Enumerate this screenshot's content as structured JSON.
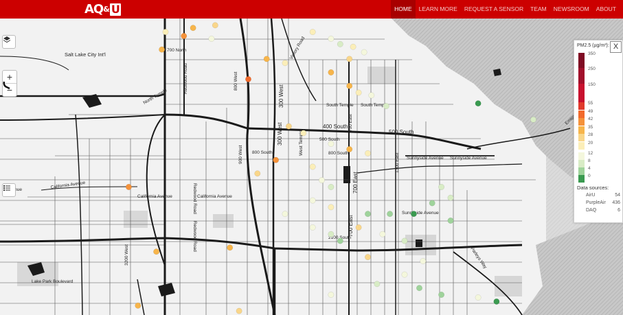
{
  "header": {
    "logo_aq": "AQ",
    "logo_amp": "&",
    "logo_u": "U",
    "nav": [
      "HOME",
      "LEARN MORE",
      "REQUEST A SENSOR",
      "TEAM",
      "NEWSROOM",
      "ABOUT"
    ],
    "active": "HOME",
    "brand_color": "#cc0000"
  },
  "controls": {
    "layers_icon": "layers-icon",
    "zoom_in": "+",
    "zoom_out": "−",
    "draw_icon": "lasso-icon",
    "list_icon": "list-icon"
  },
  "legend": {
    "title": "PM2.5 (µg/m³):",
    "close": "X",
    "ticks": [
      "350",
      "250",
      "150",
      "55",
      "49",
      "42",
      "35",
      "28",
      "20",
      "12",
      "8",
      "4",
      "0"
    ],
    "colors": [
      "#7f0b23",
      "#a10f2b",
      "#c8102e",
      "#e03a2c",
      "#f26a2b",
      "#f5923a",
      "#f7b54b",
      "#f9d68a",
      "#fbeeb8",
      "#f4f7dc",
      "#d8ecc5",
      "#9fd39b",
      "#3a9a50"
    ],
    "sources_title": "Data sources:",
    "sources": [
      {
        "name": "AirU",
        "count": "54"
      },
      {
        "name": "PurpleAir",
        "count": "436"
      },
      {
        "name": "DAQ",
        "count": "6"
      }
    ]
  },
  "map_labels": {
    "airport": "Salt Lake City Int'l",
    "s700n": "700 North",
    "redwood": "Redwood Road",
    "north_temple": "North Temple",
    "s800w": "800 West",
    "s900w": "900 West",
    "s300w": "300 West",
    "victory": "Victory Road",
    "south_temple": "South Temple",
    "s400s": "400 South",
    "s500s": "500 South",
    "s800s": "800 South",
    "west_temple": "West Temple",
    "s700e": "700 East",
    "s1300e": "1300 East",
    "sunnyside": "Sunnyside Avenue",
    "california": "California Avenue",
    "s2100s": "2100 South",
    "parleys": "Parleys Way",
    "emigration": "Emigration",
    "lake_park": "Lake Park Boulevard",
    "s3200w": "3200 West",
    "avenue": "Avenue"
  },
  "sensors": [
    {
      "lat": 40.835,
      "lon": -111.96,
      "pm": 20
    },
    {
      "lat": 40.832,
      "lon": -111.95,
      "pm": 42
    },
    {
      "lat": 40.838,
      "lon": -111.945,
      "pm": 35
    },
    {
      "lat": 40.84,
      "lon": -111.933,
      "pm": 28
    },
    {
      "lat": 40.822,
      "lon": -111.962,
      "pm": 35
    },
    {
      "lat": 40.83,
      "lon": -111.935,
      "pm": 12
    },
    {
      "lat": 40.8,
      "lon": -111.915,
      "pm": 49
    },
    {
      "lat": 40.815,
      "lon": -111.905,
      "pm": 35
    },
    {
      "lat": 40.812,
      "lon": -111.895,
      "pm": 20
    },
    {
      "lat": 40.835,
      "lon": -111.88,
      "pm": 20
    },
    {
      "lat": 40.83,
      "lon": -111.87,
      "pm": 12
    },
    {
      "lat": 40.826,
      "lon": -111.865,
      "pm": 8
    },
    {
      "lat": 40.824,
      "lon": -111.858,
      "pm": 20
    },
    {
      "lat": 40.82,
      "lon": -111.852,
      "pm": 12
    },
    {
      "lat": 40.815,
      "lon": -111.86,
      "pm": 28
    },
    {
      "lat": 40.805,
      "lon": -111.87,
      "pm": 35
    },
    {
      "lat": 40.795,
      "lon": -111.86,
      "pm": 35
    },
    {
      "lat": 40.79,
      "lon": -111.855,
      "pm": 20
    },
    {
      "lat": 40.788,
      "lon": -111.848,
      "pm": 12
    },
    {
      "lat": 40.78,
      "lon": -111.84,
      "pm": 8
    },
    {
      "lat": 40.782,
      "lon": -111.79,
      "pm": 0
    },
    {
      "lat": 40.77,
      "lon": -111.76,
      "pm": 8
    },
    {
      "lat": 40.765,
      "lon": -111.893,
      "pm": 28
    },
    {
      "lat": 40.76,
      "lon": -111.885,
      "pm": 20
    },
    {
      "lat": 40.752,
      "lon": -111.87,
      "pm": 12
    },
    {
      "lat": 40.748,
      "lon": -111.86,
      "pm": 35
    },
    {
      "lat": 40.745,
      "lon": -111.85,
      "pm": 20
    },
    {
      "lat": 40.74,
      "lon": -111.9,
      "pm": 42
    },
    {
      "lat": 40.73,
      "lon": -111.91,
      "pm": 28
    },
    {
      "lat": 40.735,
      "lon": -111.88,
      "pm": 20
    },
    {
      "lat": 40.725,
      "lon": -111.875,
      "pm": 12
    },
    {
      "lat": 40.72,
      "lon": -111.87,
      "pm": 8
    },
    {
      "lat": 40.72,
      "lon": -111.98,
      "pm": 42
    },
    {
      "lat": 40.71,
      "lon": -111.88,
      "pm": 12
    },
    {
      "lat": 40.705,
      "lon": -111.87,
      "pm": 20
    },
    {
      "lat": 40.7,
      "lon": -111.85,
      "pm": 4
    },
    {
      "lat": 40.7,
      "lon": -111.838,
      "pm": 4
    },
    {
      "lat": 40.7,
      "lon": -111.825,
      "pm": 0
    },
    {
      "lat": 40.712,
      "lon": -111.805,
      "pm": 8
    },
    {
      "lat": 40.708,
      "lon": -111.815,
      "pm": 4
    },
    {
      "lat": 40.72,
      "lon": -111.81,
      "pm": 8
    },
    {
      "lat": 40.695,
      "lon": -111.805,
      "pm": 4
    },
    {
      "lat": 40.7,
      "lon": -111.895,
      "pm": 12
    },
    {
      "lat": 40.69,
      "lon": -111.88,
      "pm": 12
    },
    {
      "lat": 40.685,
      "lon": -111.87,
      "pm": 8
    },
    {
      "lat": 40.68,
      "lon": -111.865,
      "pm": 4
    },
    {
      "lat": 40.69,
      "lon": -111.855,
      "pm": 28
    },
    {
      "lat": 40.685,
      "lon": -111.842,
      "pm": 12
    },
    {
      "lat": 40.68,
      "lon": -111.83,
      "pm": 8
    },
    {
      "lat": 40.675,
      "lon": -111.925,
      "pm": 35
    },
    {
      "lat": 40.672,
      "lon": -111.965,
      "pm": 35
    },
    {
      "lat": 40.668,
      "lon": -111.85,
      "pm": 28
    },
    {
      "lat": 40.665,
      "lon": -111.82,
      "pm": 12
    },
    {
      "lat": 40.655,
      "lon": -111.83,
      "pm": 12
    },
    {
      "lat": 40.648,
      "lon": -111.845,
      "pm": 8
    },
    {
      "lat": 40.645,
      "lon": -111.822,
      "pm": 4
    },
    {
      "lat": 40.64,
      "lon": -111.81,
      "pm": 4
    },
    {
      "lat": 40.638,
      "lon": -111.79,
      "pm": 12
    },
    {
      "lat": 40.635,
      "lon": -111.78,
      "pm": 0
    },
    {
      "lat": 40.632,
      "lon": -111.975,
      "pm": 35
    },
    {
      "lat": 40.628,
      "lon": -111.92,
      "pm": 28
    },
    {
      "lat": 40.64,
      "lon": -111.87,
      "pm": 12
    }
  ]
}
